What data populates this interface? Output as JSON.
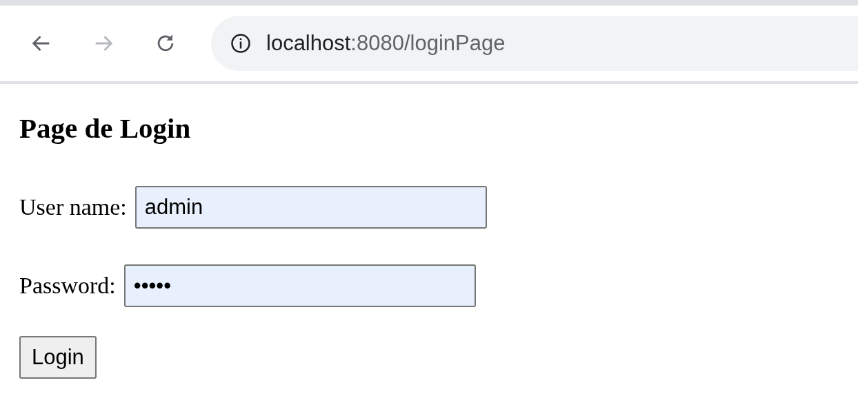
{
  "browser": {
    "nav_buttons": [
      {
        "kind": "back",
        "disabled": false
      },
      {
        "kind": "forward",
        "disabled": true
      },
      {
        "kind": "reload",
        "disabled": false
      }
    ],
    "address": {
      "host": "localhost",
      "path": ":8080/loginPage"
    }
  },
  "page": {
    "heading": "Page de Login",
    "fields": [
      {
        "label": "User name:",
        "value": "admin"
      },
      {
        "label": "Password:",
        "value": "•••••"
      }
    ],
    "button": "Login"
  }
}
